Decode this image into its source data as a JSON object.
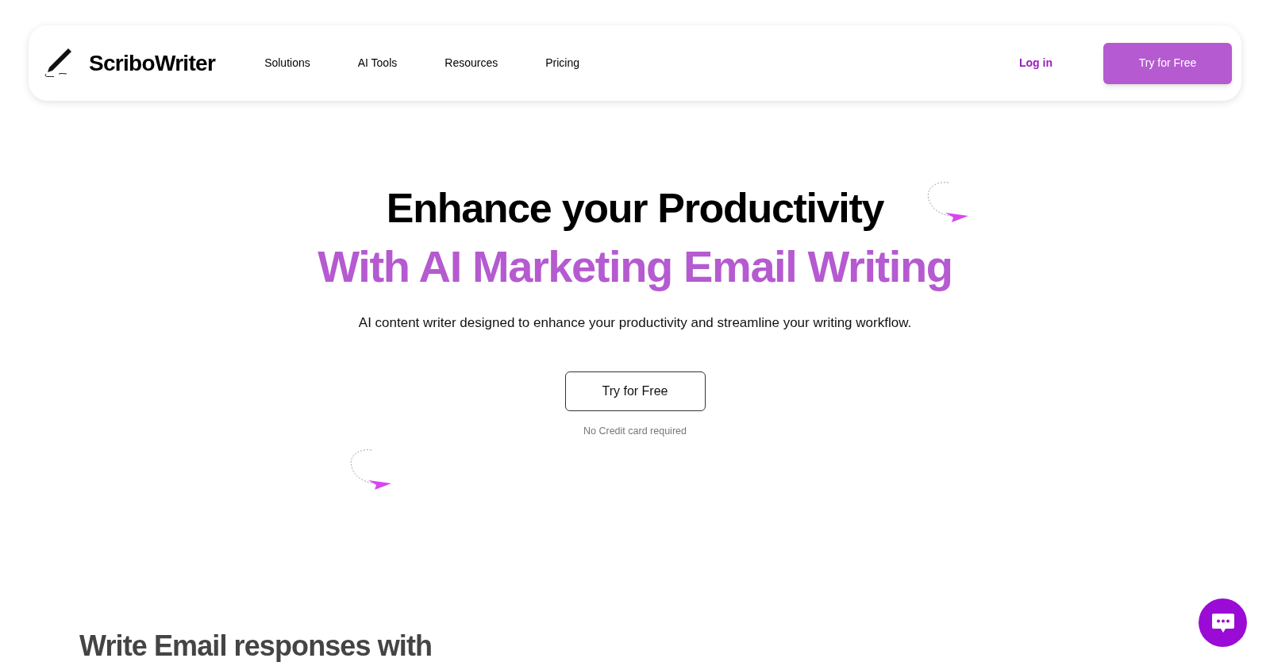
{
  "header": {
    "logo_text": "ScriboWriter",
    "nav": [
      {
        "label": "Solutions"
      },
      {
        "label": "AI Tools"
      },
      {
        "label": "Resources"
      },
      {
        "label": "Pricing"
      }
    ],
    "login": "Log in",
    "cta": "Try for Free"
  },
  "hero": {
    "title": "Enhance your Productivity",
    "subtitle": "With AI Marketing Email Writing",
    "description": "AI content writer designed to enhance your productivity and streamline your writing workflow.",
    "button": "Try for Free",
    "note": "No Credit card required"
  },
  "section": {
    "heading": "Write Email responses with"
  }
}
